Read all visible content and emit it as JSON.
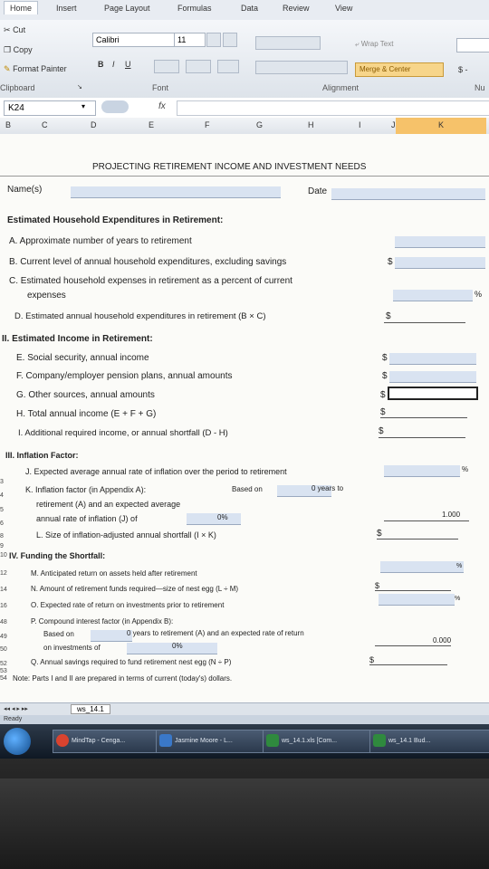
{
  "ribbon": {
    "tabs": [
      "Home",
      "Insert",
      "Page Layout",
      "Formulas",
      "Data",
      "Review",
      "View"
    ],
    "clipboard": {
      "cut": "Cut",
      "copy": "Copy",
      "format_painter": "Format Painter",
      "label": "Clipboard"
    },
    "font": {
      "name": "Calibri",
      "size": "11",
      "label": "Font",
      "bold": "B",
      "italic": "I",
      "underline": "U"
    },
    "alignment": {
      "wrap": "Wrap Text",
      "merge": "Merge & Center",
      "label": "Alignment"
    },
    "number": {
      "currency": "$ -",
      "label": "Nu"
    }
  },
  "formula_bar": {
    "cell_ref": "K24",
    "fx": "fx"
  },
  "columns": [
    "B",
    "C",
    "D",
    "E",
    "F",
    "G",
    "H",
    "I",
    "J",
    "K"
  ],
  "sheet": {
    "title": "PROJECTING RETIREMENT INCOME AND INVESTMENT NEEDS",
    "names_label": "Name(s)",
    "date_label": "Date",
    "s1": {
      "heading": "Estimated Household Expenditures in Retirement:",
      "a": "A. Approximate number of years to retirement",
      "b": "B. Current level of annual household expenditures, excluding savings",
      "c1": "C. Estimated household expenses in retirement as a percent of current",
      "c2": "expenses",
      "d": "D. Estimated annual household expenditures in retirement (B × C)"
    },
    "s2": {
      "heading": "II. Estimated Income in Retirement:",
      "e": "E. Social security, annual income",
      "f": "F. Company/employer pension plans, annual amounts",
      "g": "G. Other sources, annual amounts",
      "h": "H. Total annual income (E + F + G)",
      "i": "I. Additional required income, or annual shortfall (D - H)"
    },
    "s3": {
      "heading": "III. Inflation Factor:",
      "j": "J. Expected average annual rate of inflation over the period to retirement",
      "k1": "K. Inflation factor (in Appendix A):",
      "k_based": "Based on",
      "k_years": "0 years to",
      "k2": "retirement (A) and an expected average",
      "k3": "annual rate of inflation (J) of",
      "k_pct": "0%",
      "k_val": "1.000",
      "l": "L. Size of inflation-adjusted annual shortfall (I × K)"
    },
    "s4": {
      "heading": "IV. Funding the Shortfall:",
      "m": "M. Anticipated return on assets held after retirement",
      "n": "N. Amount of retirement funds required—size of nest egg (L ÷ M)",
      "o": "O. Expected rate of return on investments prior to retirement",
      "p1": "P. Compound interest factor (in Appendix B):",
      "p_based": "Based on",
      "p_years": "0 years to retirement (A) and an expected rate of return",
      "p_on": "on investments of",
      "p_pct": "0%",
      "p_val": "0.000",
      "q": "Q. Annual savings required to fund retirement nest egg (N ÷ P)"
    },
    "note": "Note: Parts I and II are prepared in terms of current (today's) dollars.",
    "dollar": "$",
    "percent": "%",
    "row_numbers": [
      "3",
      "4",
      "5",
      "6",
      "7",
      "8",
      "9",
      "10",
      "12",
      "14",
      "16",
      "48",
      "49",
      "50",
      "52",
      "53",
      "54"
    ]
  },
  "sheet_tab": "ws_14.1",
  "status": "Ready",
  "taskbar": [
    "MindTap - Cenga...",
    "Jasmine Moore - L...",
    "ws_14.1.xls [Com...",
    "ws_14.1 Bud..."
  ]
}
